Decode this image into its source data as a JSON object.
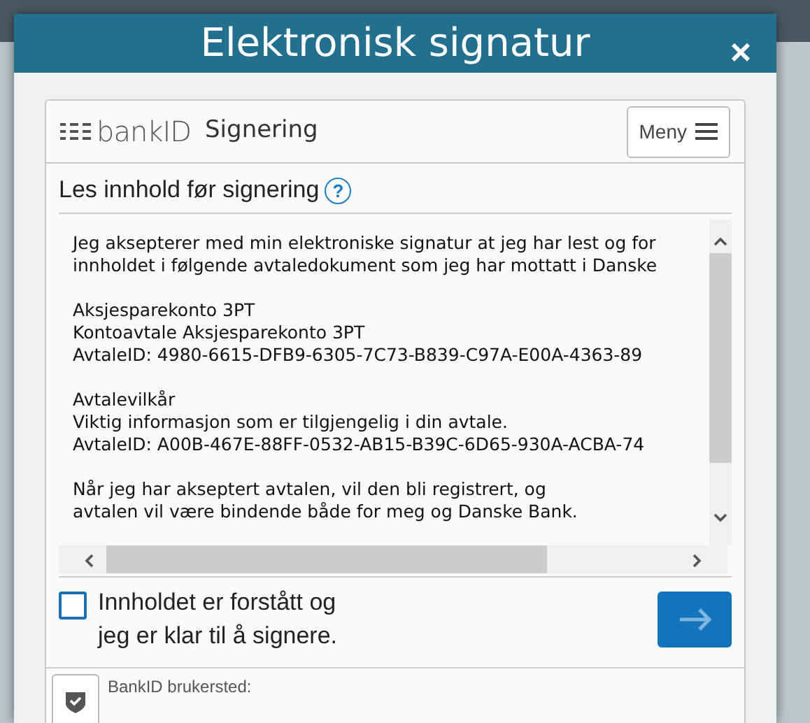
{
  "dialog": {
    "title": "Elektronisk signatur",
    "close": "×"
  },
  "bankid": {
    "logo_text": "bankID",
    "title": "Signering",
    "menu_button": "Meny"
  },
  "section": {
    "heading": "Les innhold før signering",
    "help": "?"
  },
  "document": {
    "paragraphs": [
      [
        "Jeg aksepterer med min elektroniske signatur at jeg har lest og for",
        "innholdet i følgende avtaledokument som jeg har mottatt i Danske"
      ],
      [
        "Aksjesparekonto 3PT",
        "Kontoavtale Aksjesparekonto 3PT",
        "AvtaleID: 4980-6615-DFB9-6305-7C73-B839-C97A-E00A-4363-89"
      ],
      [
        "Avtalevilkår",
        "Viktig informasjon som er tilgjengelig i din avtale.",
        "AvtaleID: A00B-467E-88FF-0532-AB15-B39C-6D65-930A-ACBA-74"
      ],
      [
        "Når jeg har akseptert avtalen, vil den bli registrert, og",
        "avtalen vil være bindende både for meg og Danske Bank."
      ]
    ]
  },
  "confirm": {
    "label_lines": [
      "Innholdet er forstått og",
      "jeg er klar til å signere."
    ],
    "checked": false
  },
  "merchant": {
    "label": "BankID brukersted:"
  }
}
